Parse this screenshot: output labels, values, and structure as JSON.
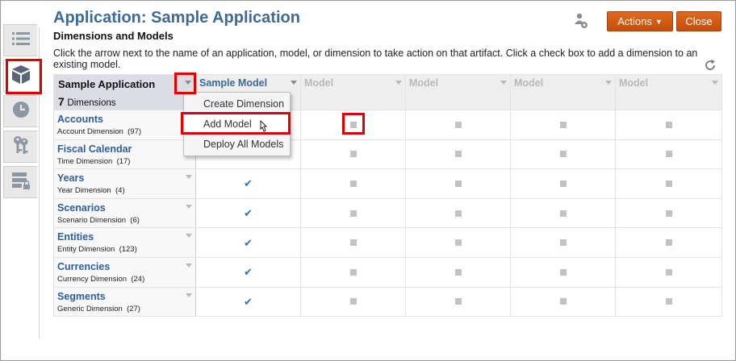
{
  "header": {
    "title": "Application: Sample Application",
    "subtitle": "Dimensions and Models",
    "help": "Click the arrow next to the name of an application, model, or dimension to take action on that artifact. Click a check box to add a dimension to an existing model.",
    "actions_label": "Actions",
    "close_label": "Close"
  },
  "rail": {
    "items": [
      "list-icon",
      "cube-icon",
      "clock-icon",
      "keys-icon",
      "server-lock-icon"
    ],
    "active": "cube-icon"
  },
  "grid": {
    "app_name": "Sample Application",
    "dim_count": "7",
    "dim_count_label": "Dimensions",
    "models": [
      "Sample Model",
      "Model",
      "Model",
      "Model",
      "Model"
    ],
    "dimensions": [
      {
        "name": "Accounts",
        "type": "Account Dimension",
        "count": "(97)"
      },
      {
        "name": "Fiscal Calendar",
        "type": "Time Dimension",
        "count": "(17)"
      },
      {
        "name": "Years",
        "type": "Year Dimension",
        "count": "(4)"
      },
      {
        "name": "Scenarios",
        "type": "Scenario Dimension",
        "count": "(6)"
      },
      {
        "name": "Entities",
        "type": "Entity Dimension",
        "count": "(123)"
      },
      {
        "name": "Currencies",
        "type": "Currency Dimension",
        "count": "(24)"
      },
      {
        "name": "Segments",
        "type": "Generic Dimension",
        "count": "(27)"
      }
    ]
  },
  "menu": {
    "items": [
      "Create Dimension",
      "Add Model",
      "Deploy All Models"
    ],
    "selected": "Add Model"
  },
  "colors": {
    "accent": "#3d6a99",
    "button": "#d55a14",
    "highlight": "#e00000",
    "check": "#2d6fb4"
  }
}
